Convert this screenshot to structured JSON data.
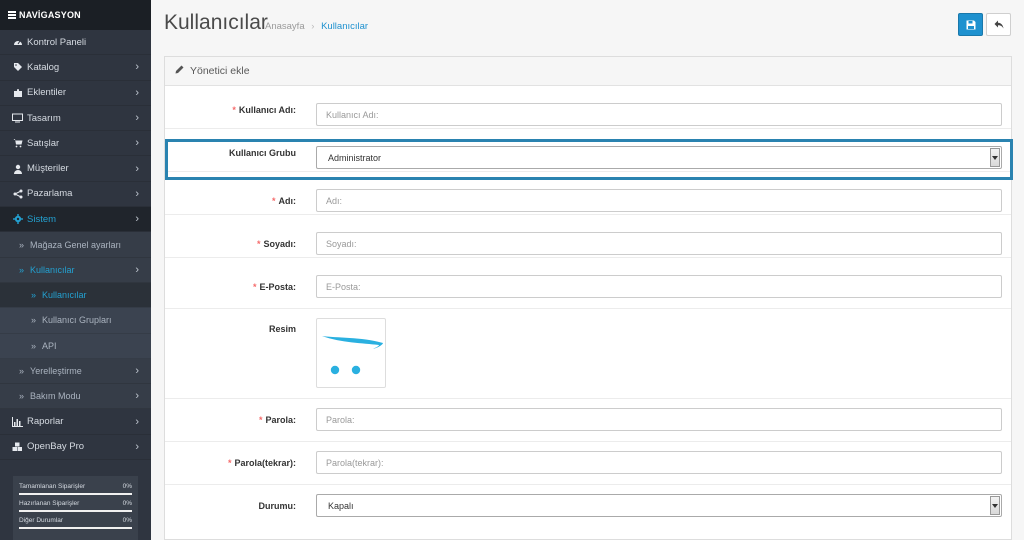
{
  "sidebar": {
    "header": "NAVİGASYON",
    "items": [
      {
        "label": "Kontrol Paneli",
        "icon": "dashboard-icon",
        "arrow": false
      },
      {
        "label": "Katalog",
        "icon": "tags-icon",
        "arrow": true
      },
      {
        "label": "Eklentiler",
        "icon": "puzzle-icon",
        "arrow": true
      },
      {
        "label": "Tasarım",
        "icon": "monitor-icon",
        "arrow": true
      },
      {
        "label": "Satışlar",
        "icon": "cart-icon",
        "arrow": true
      },
      {
        "label": "Müşteriler",
        "icon": "user-icon",
        "arrow": true
      },
      {
        "label": "Pazarlama",
        "icon": "share-icon",
        "arrow": true
      },
      {
        "label": "Sistem",
        "icon": "gear-icon",
        "arrow": true
      }
    ],
    "sistem_sub": [
      {
        "label": "Mağaza Genel ayarları"
      },
      {
        "label": "Kullanıcılar"
      },
      {
        "label": "Kullanıcılar"
      },
      {
        "label": "Kullanıcı Grupları"
      },
      {
        "label": "API"
      },
      {
        "label": "Yerelleştirme"
      },
      {
        "label": "Bakım Modu"
      }
    ],
    "bottom_items": [
      {
        "label": "Raporlar",
        "icon": "bar-chart-icon"
      },
      {
        "label": "OpenBay Pro",
        "icon": "cubes-icon"
      }
    ],
    "status": [
      {
        "label": "Tamamlanan Siparişler",
        "value": "0%"
      },
      {
        "label": "Hazırlanan Siparişler",
        "value": "0%"
      },
      {
        "label": "Diğer Durumlar",
        "value": "0%"
      }
    ]
  },
  "header": {
    "title": "Kullanıcılar",
    "breadcrumb_home": "Anasayfa",
    "breadcrumb_sep": "›",
    "breadcrumb_current": "Kullanıcılar"
  },
  "panel": {
    "title": "Yönetici ekle"
  },
  "form": {
    "username": {
      "label": "Kullanıcı Adı:",
      "placeholder": "Kullanıcı Adı:",
      "value": ""
    },
    "group": {
      "label": "Kullanıcı Grubu",
      "value": "Administrator"
    },
    "firstname": {
      "label": "Adı:",
      "placeholder": "Adı:",
      "value": ""
    },
    "lastname": {
      "label": "Soyadı:",
      "placeholder": "Soyadı:",
      "value": ""
    },
    "email": {
      "label": "E-Posta:",
      "placeholder": "E-Posta:",
      "value": ""
    },
    "image": {
      "label": "Resim"
    },
    "password": {
      "label": "Parola:",
      "placeholder": "Parola:",
      "value": ""
    },
    "confirm": {
      "label": "Parola(tekrar):",
      "placeholder": "Parola(tekrar):",
      "value": ""
    },
    "status": {
      "label": "Durumu:",
      "value": "Kapalı"
    }
  },
  "colors": {
    "accent": "#1e91cf",
    "sidebar_bg": "#2f3540",
    "required": "#f56b6b",
    "highlight": "#2a83b0"
  }
}
